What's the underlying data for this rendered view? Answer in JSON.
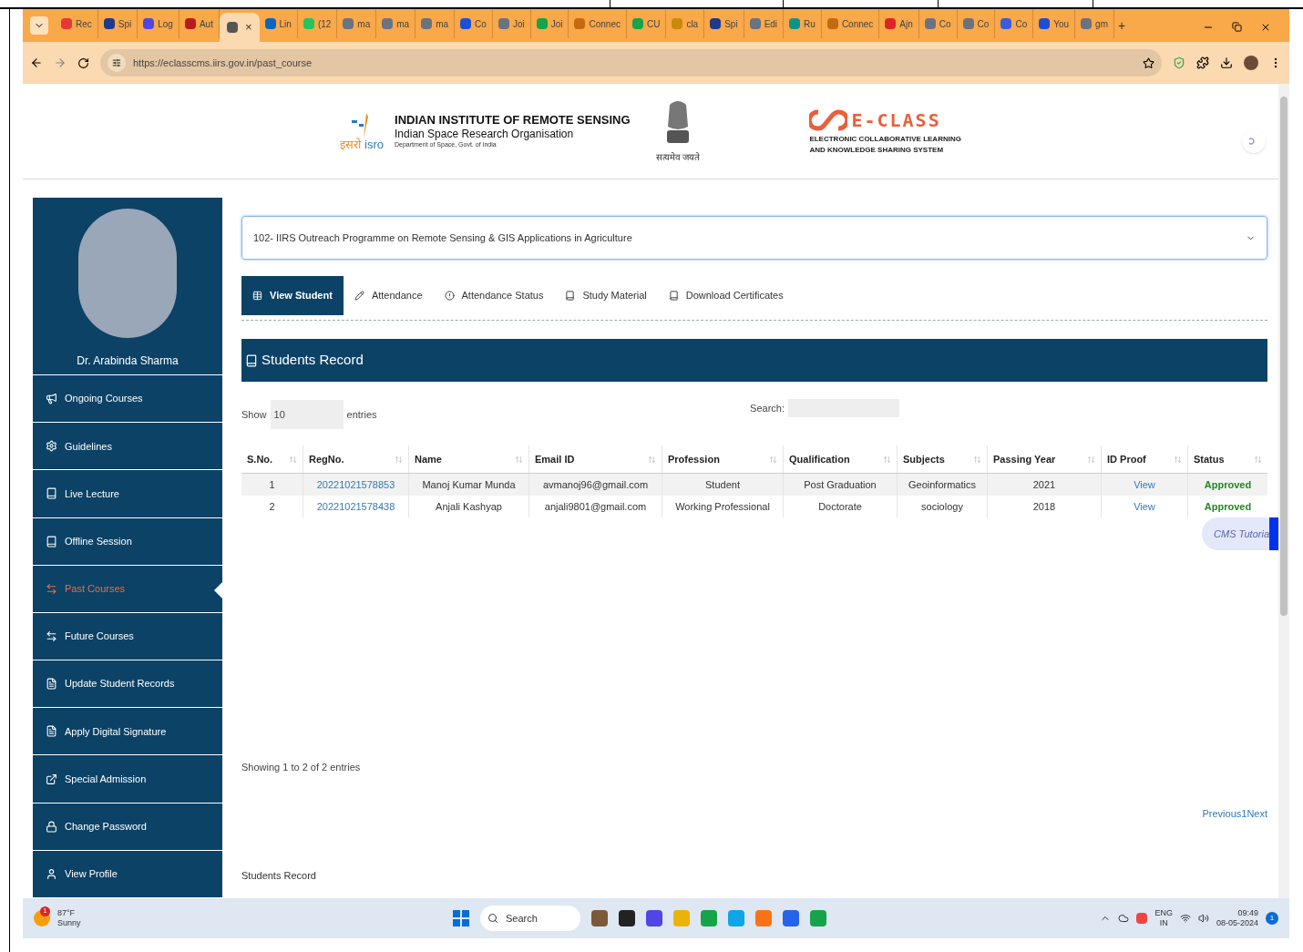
{
  "browser": {
    "tabs": [
      {
        "label": "Rec",
        "color": "#e53935",
        "selected": false
      },
      {
        "label": "Spi",
        "color": "#1e3a8a",
        "selected": false
      },
      {
        "label": "Log",
        "color": "#4f46e5",
        "selected": false
      },
      {
        "label": "Aut",
        "color": "#b91c1c",
        "selected": false
      },
      {
        "color": "#555555",
        "selected": true
      },
      {
        "label": "Lin",
        "color": "#0a66c2",
        "selected": false
      },
      {
        "label": "(12",
        "color": "#22c55e",
        "selected": false
      },
      {
        "label": "ma",
        "color": "#6b7280",
        "selected": false
      },
      {
        "label": "ma",
        "color": "#6b7280",
        "selected": false
      },
      {
        "label": "ma",
        "color": "#6b7280",
        "selected": false
      },
      {
        "label": "Co",
        "color": "#1d4ed8",
        "selected": false
      },
      {
        "label": "Joi",
        "color": "#6b7280",
        "selected": false
      },
      {
        "label": "Joi",
        "color": "#16a34a",
        "selected": false
      },
      {
        "label": "Connec",
        "color": "#c46a10",
        "selected": false
      },
      {
        "label": "CU",
        "color": "#16a34a",
        "selected": false
      },
      {
        "label": "cla",
        "color": "#ca8a04",
        "selected": false
      },
      {
        "label": "Spi",
        "color": "#1e3a8a",
        "selected": false
      },
      {
        "label": "Edi",
        "color": "#6b7280",
        "selected": false
      },
      {
        "label": "Ru",
        "color": "#0d9488",
        "selected": false
      },
      {
        "label": "Connec",
        "color": "#c46a10",
        "selected": false
      },
      {
        "label": "Ajn",
        "color": "#dc2626",
        "selected": false
      },
      {
        "label": "Co",
        "color": "#6b7280",
        "selected": false
      },
      {
        "label": "Co",
        "color": "#6b7280",
        "selected": false
      },
      {
        "label": "Co",
        "color": "#3b5bdb",
        "selected": false
      },
      {
        "label": "You",
        "color": "#1d4ed8",
        "selected": false
      },
      {
        "label": "gm",
        "color": "#6b7280",
        "selected": false
      }
    ],
    "close_glyph": "×",
    "new_tab": "+",
    "url": "https://eclasscms.iirs.gov.in/past_course"
  },
  "header": {
    "institute": "INDIAN INSTITUTE OF REMOTE SENSING",
    "org": "Indian Space Research Organisation",
    "dept": "Department of Space, Govt. of India",
    "isro_hindi": "इसरो",
    "isro_latin": "isro",
    "emblem_motto": "सत्यमेव जयते",
    "eclass_title": "E-CLASS",
    "eclass_sub1": "ELECTRONIC COLLABORATIVE LEARNING",
    "eclass_sub2": "AND KNOWLEDGE SHARING SYSTEM"
  },
  "sidebar": {
    "user_name": "Dr. Arabinda Sharma",
    "items": [
      {
        "label": "Ongoing Courses",
        "selected": false
      },
      {
        "label": "Guidelines",
        "selected": false
      },
      {
        "label": "Live Lecture",
        "selected": false
      },
      {
        "label": "Offline Session",
        "selected": false
      },
      {
        "label": "Past Courses",
        "selected": true
      },
      {
        "label": "Future Courses",
        "selected": false
      },
      {
        "label": "Update Student Records",
        "selected": false
      },
      {
        "label": "Apply Digital Signature",
        "selected": false
      },
      {
        "label": "Special Admission",
        "selected": false
      },
      {
        "label": "Change Password",
        "selected": false
      },
      {
        "label": "View Profile",
        "selected": false
      }
    ]
  },
  "course_select": {
    "value": "102- IIRS Outreach Programme on Remote Sensing & GIS Applications in Agriculture"
  },
  "tabs": [
    {
      "label": "View Student",
      "selected": true
    },
    {
      "label": "Attendance",
      "selected": false
    },
    {
      "label": "Attendance Status",
      "selected": false
    },
    {
      "label": "Study Material",
      "selected": false
    },
    {
      "label": "Download Certificates",
      "selected": false
    }
  ],
  "panel_title": "Students Record",
  "table": {
    "show_label": "Show",
    "page_size": "10",
    "entries_label": "entries",
    "search_label": "Search:",
    "columns": [
      "S.No.",
      "RegNo.",
      "Name",
      "Email ID",
      "Profession",
      "Qualification",
      "Subjects",
      "Passing Year",
      "ID Proof",
      "Status"
    ],
    "rows": [
      [
        "1",
        "20221021578853",
        "Manoj Kumar Munda",
        "avmanoj96@gmail.com",
        "Student",
        "Post Graduation",
        "Geoinformatics",
        "2021",
        "View",
        "Approved"
      ],
      [
        "2",
        "20221021578438",
        "Anjali Kashyap",
        "anjali9801@gmail.com",
        "Working Professional",
        "Doctorate",
        "sociology",
        "2018",
        "View",
        "Approved"
      ]
    ],
    "info": "Showing 1 to 2 of 2 entries",
    "prev": "Previous",
    "page": "1",
    "next": "Next"
  },
  "footer_caption": "Students Record",
  "floating_button": "CMS Tutoria",
  "taskbar": {
    "weather_badge": "1",
    "temp": "87°F",
    "condition": "Sunny",
    "search": "Search",
    "lang": "ENG",
    "region": "IN",
    "time": "09:49",
    "date": "08-05-2024",
    "notif": "1"
  }
}
